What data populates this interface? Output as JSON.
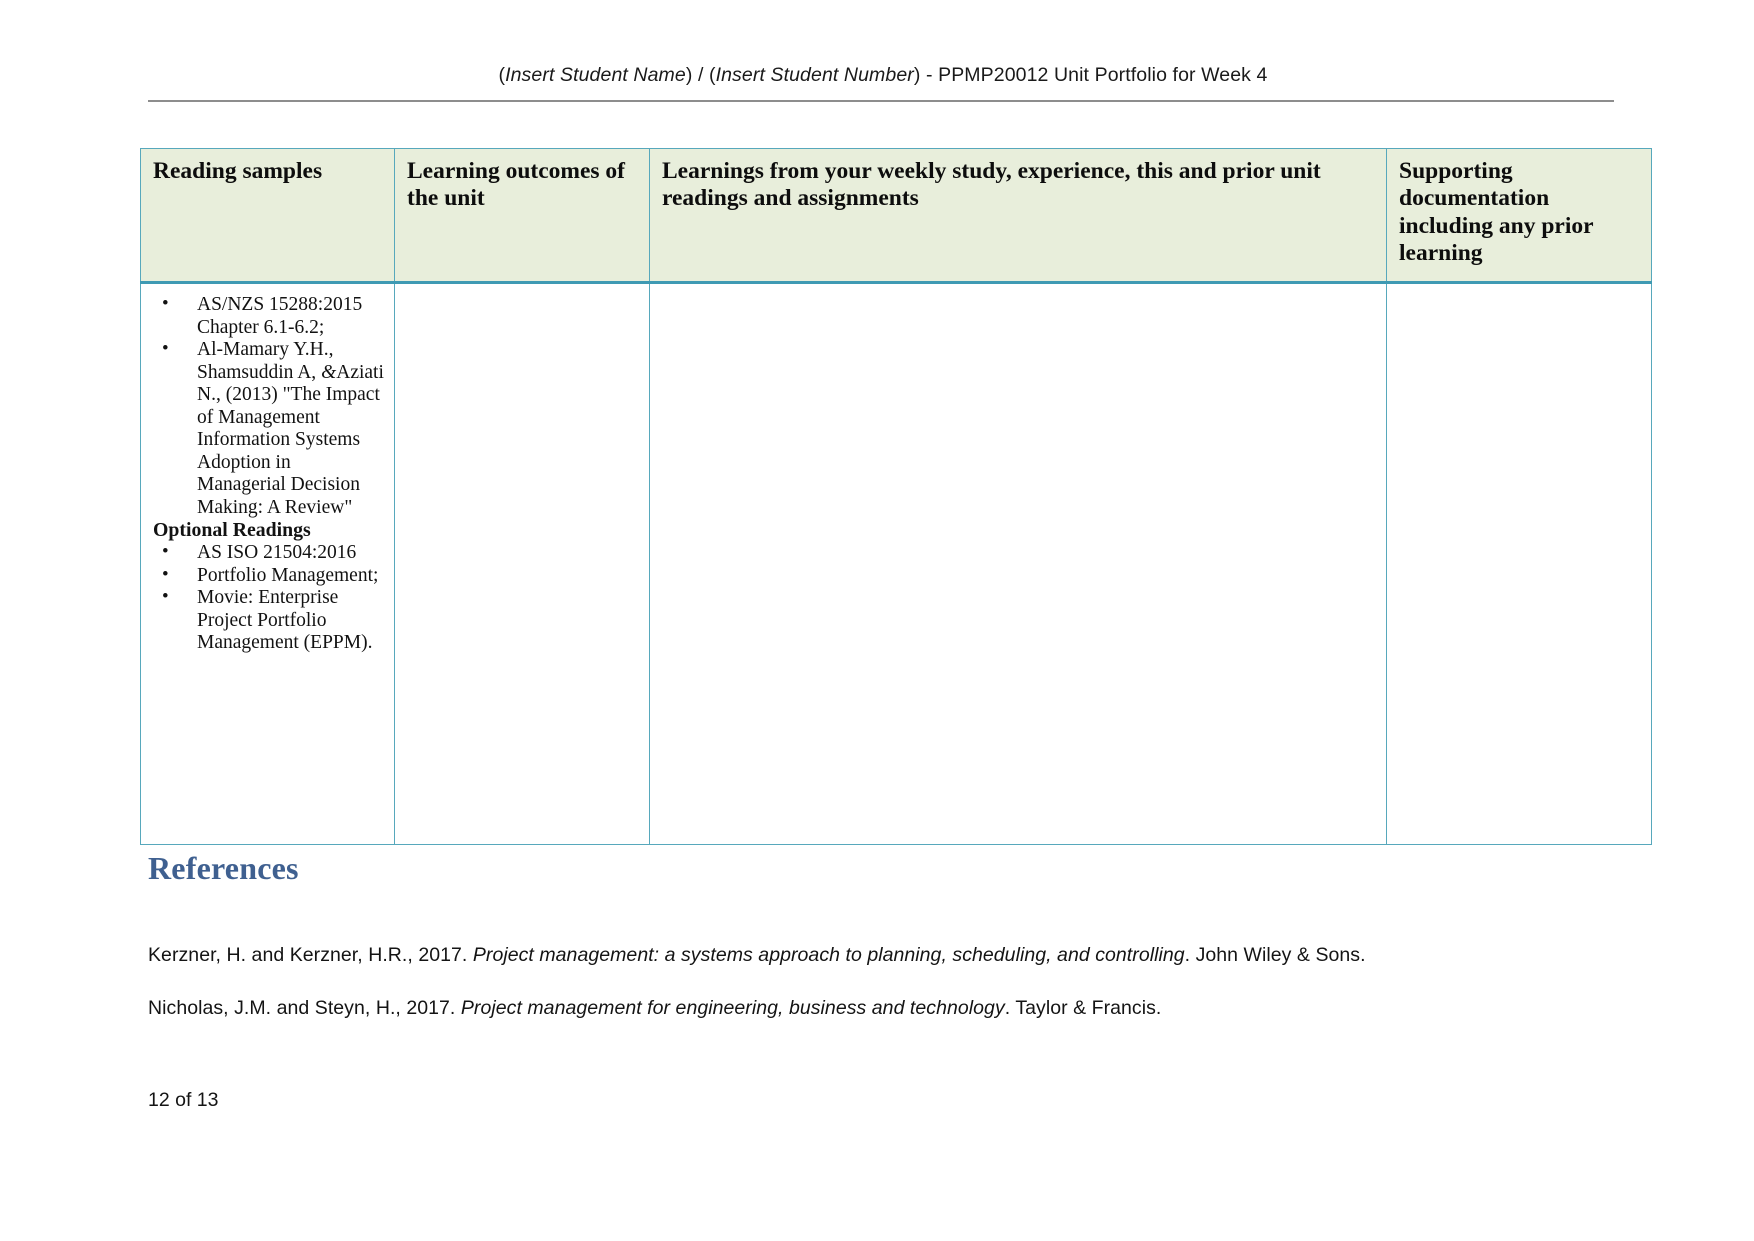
{
  "header": {
    "prefix_open": "(",
    "student_name": "Insert Student Name",
    "mid": ") / (",
    "student_number": "Insert Student Number",
    "suffix": ") - PPMP20012 Unit Portfolio for Week 4"
  },
  "table": {
    "columns": [
      "Reading samples",
      "Learning outcomes of the unit",
      "Learnings from your weekly study, experience, this and prior unit readings and assignments",
      "Supporting documentation including any prior learning"
    ],
    "readings": [
      {
        "type": "bullet",
        "text": "AS/NZS 15288:2015 Chapter 6.1-6.2;"
      },
      {
        "type": "bullet_rich",
        "pre": "Al-Mamary Y.H., Shamsuddin A, ",
        "amp": "&",
        "post": "Aziati N., (2013) \"The Impact of Management Information Systems Adoption in Managerial Decision Making: A Review\""
      },
      {
        "type": "subhead",
        "text": "Optional Readings"
      },
      {
        "type": "bullet",
        "text": "AS ISO 21504:2016"
      },
      {
        "type": "bullet",
        "text": "Portfolio Management;"
      },
      {
        "type": "bullet",
        "text": "Movie:  Enterprise Project Portfolio Management (EPPM)."
      }
    ],
    "cell_values": {
      "learning_outcomes": "",
      "learnings": "",
      "supporting_documentation": ""
    }
  },
  "references": {
    "heading": "References",
    "items": [
      {
        "authors_year": "Kerzner, H. and Kerzner, H.R., 2017. ",
        "title": "Project management: a systems approach to planning, scheduling, and controlling",
        "publisher": ". John Wiley & Sons."
      },
      {
        "authors_year": "Nicholas, J.M. and Steyn, H., 2017. ",
        "title": "Project management for engineering, business and technology",
        "publisher": ". Taylor & Francis."
      }
    ]
  },
  "footer": {
    "page_label": "12 of 13"
  },
  "colors": {
    "table_border": "#57a8bc",
    "header_fill": "#e8eedb",
    "heading_blue": "#3f6090",
    "rule_grey": "#8d8d8d"
  }
}
